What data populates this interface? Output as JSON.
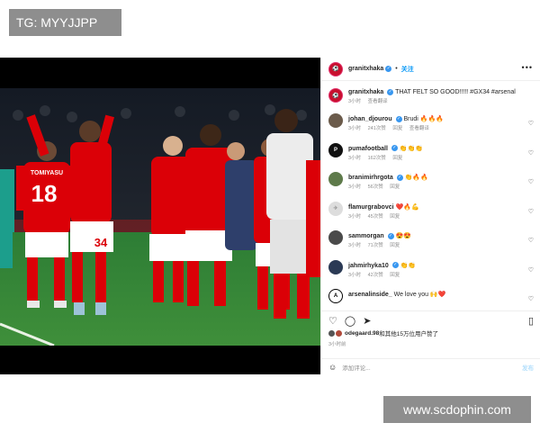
{
  "watermarks": {
    "top": "TG: MYYJJPP",
    "bottom": "www.scdophin.com"
  },
  "post": {
    "author": "granitxhaka",
    "follow_label": "关注",
    "separator": "•",
    "more_label": "•••",
    "caption": {
      "user": "granitxhaka",
      "text": "THAT FELT SO GOOD!!!!! #GX34 #arsenal",
      "time": "3小时",
      "translate": "查看翻译"
    },
    "players": {
      "left": {
        "name": "TOMIYASU",
        "number": "18"
      },
      "right": {
        "number": "34"
      }
    },
    "comments": [
      {
        "user": "johan_djourou",
        "verified": true,
        "text": "Brudi 🔥🔥🔥",
        "time": "3小时",
        "likes": "241次赞",
        "reply": "回复",
        "translate": "查看翻译",
        "avatar_color": "#6b5b4b"
      },
      {
        "user": "pumafootball",
        "verified": true,
        "text": "👏👏👏",
        "time": "3小时",
        "likes": "162次赞",
        "reply": "回复",
        "translate": "",
        "avatar_color": "#111111"
      },
      {
        "user": "branimirhrgota",
        "verified": true,
        "text": "👏🔥🔥",
        "time": "3小时",
        "likes": "56次赞",
        "reply": "回复",
        "translate": "",
        "avatar_color": "#5e7a4a"
      },
      {
        "user": "flamurgrabovci",
        "verified": false,
        "text": "❤️🔥💪",
        "time": "3小时",
        "likes": "45次赞",
        "reply": "回复",
        "translate": "",
        "avatar_color": "#dddddd"
      },
      {
        "user": "sammorgan",
        "verified": true,
        "text": "😍😍",
        "time": "3小时",
        "likes": "71次赞",
        "reply": "回复",
        "translate": "",
        "avatar_color": "#4a4a4a"
      },
      {
        "user": "jahmirhyka10",
        "verified": true,
        "text": "👏👏",
        "time": "3小时",
        "likes": "42次赞",
        "reply": "回复",
        "translate": "",
        "avatar_color": "#2b3a55"
      },
      {
        "user": "arsenalinside_",
        "verified": false,
        "text": "We love you 🙌❤️",
        "time": "",
        "likes": "",
        "reply": "",
        "translate": "",
        "avatar_color": "#ffffff"
      }
    ],
    "actions": {
      "like_icon": "heart-icon",
      "comment_icon": "comment-icon",
      "share_icon": "share-icon",
      "save_icon": "bookmark-icon"
    },
    "likes_text_user": "odegaard.98",
    "likes_text_rest": "和其他15万位用户赞了",
    "time_ago": "3小时前",
    "add_comment_placeholder": "添加评论...",
    "post_button": "发布"
  },
  "colors": {
    "accent": "#0095f6",
    "arsenal_red": "#db0007",
    "pitch_green": "#2f7a33"
  }
}
